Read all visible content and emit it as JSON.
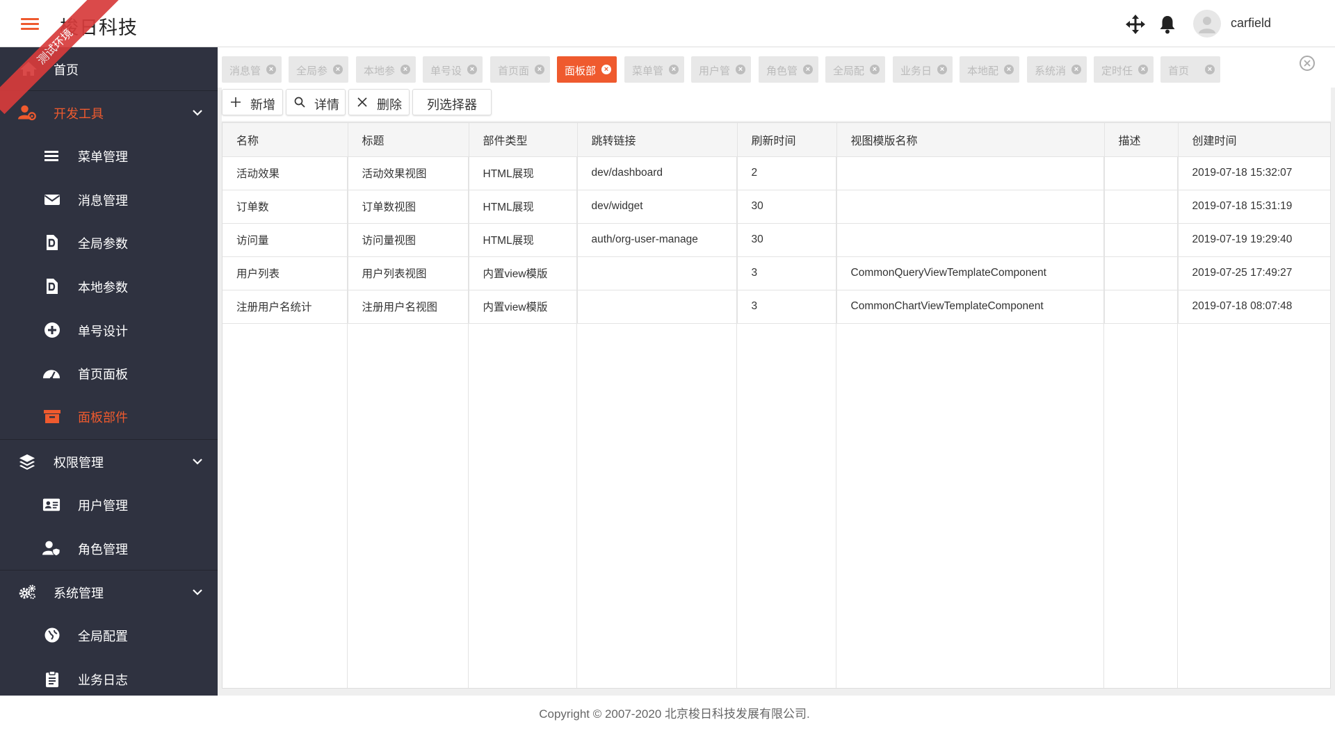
{
  "header": {
    "app_title": "梭日科技",
    "env_badge": "测试环境",
    "username": "carfield",
    "icons": [
      "menu-icon",
      "move-icon",
      "bell-icon",
      "avatar-icon"
    ],
    "accent_color": "#ef5a2e"
  },
  "sidebar": {
    "items": [
      {
        "label": "首页",
        "icon": "home-icon"
      },
      {
        "label": "开发工具",
        "icon": "user-gear-icon",
        "group": true,
        "active": true
      },
      {
        "label": "菜单管理",
        "icon": "list-icon"
      },
      {
        "label": "消息管理",
        "icon": "envelope-icon"
      },
      {
        "label": "全局参数",
        "icon": "file-d-icon"
      },
      {
        "label": "本地参数",
        "icon": "file-d-icon"
      },
      {
        "label": "单号设计",
        "icon": "plus-circle-icon"
      },
      {
        "label": "首页面板",
        "icon": "gauge-icon"
      },
      {
        "label": "面板部件",
        "icon": "archive-icon",
        "active": true
      },
      {
        "label": "权限管理",
        "icon": "layers-icon",
        "group": true
      },
      {
        "label": "用户管理",
        "icon": "id-card-icon"
      },
      {
        "label": "角色管理",
        "icon": "user-shield-icon"
      },
      {
        "label": "系统管理",
        "icon": "cogs-icon",
        "group": true
      },
      {
        "label": "全局配置",
        "icon": "globe-icon"
      },
      {
        "label": "业务日志",
        "icon": "clipboard-icon"
      }
    ]
  },
  "tabs": [
    {
      "label": "消息管"
    },
    {
      "label": "全局参"
    },
    {
      "label": "本地参"
    },
    {
      "label": "单号设"
    },
    {
      "label": "首页面"
    },
    {
      "label": "面板部",
      "active": true
    },
    {
      "label": "菜单管"
    },
    {
      "label": "用户管"
    },
    {
      "label": "角色管"
    },
    {
      "label": "全局配"
    },
    {
      "label": "业务日"
    },
    {
      "label": "本地配"
    },
    {
      "label": "系统消"
    },
    {
      "label": "定时任"
    },
    {
      "label": "首页"
    }
  ],
  "toolbar": {
    "add_label": "新增",
    "detail_label": "详情",
    "delete_label": "删除",
    "columns_label": "列选择器"
  },
  "table": {
    "columns": [
      "名称",
      "标题",
      "部件类型",
      "跳转链接",
      "刷新时间",
      "视图模版名称",
      "描述",
      "创建时间"
    ],
    "rows": [
      [
        "活动效果",
        "活动效果视图",
        "HTML展现",
        "dev/dashboard",
        "2",
        "",
        "",
        "2019-07-18 15:32:07"
      ],
      [
        "订单数",
        "订单数视图",
        "HTML展现",
        "dev/widget",
        "30",
        "",
        "",
        "2019-07-18 15:31:19"
      ],
      [
        "访问量",
        "访问量视图",
        "HTML展现",
        "auth/org-user-manage",
        "30",
        "",
        "",
        "2019-07-19 19:29:40"
      ],
      [
        "用户列表",
        "用户列表视图",
        "内置view模版",
        "",
        "3",
        "CommonQueryViewTemplateComponent",
        "",
        "2019-07-25 17:49:27"
      ],
      [
        "注册用户名统计",
        "注册用户名视图",
        "内置view模版",
        "",
        "3",
        "CommonChartViewTemplateComponent",
        "",
        "2019-07-18 08:07:48"
      ]
    ]
  },
  "footer": {
    "copyright": "Copyright © 2007-2020 北京梭日科技发展有限公司."
  }
}
